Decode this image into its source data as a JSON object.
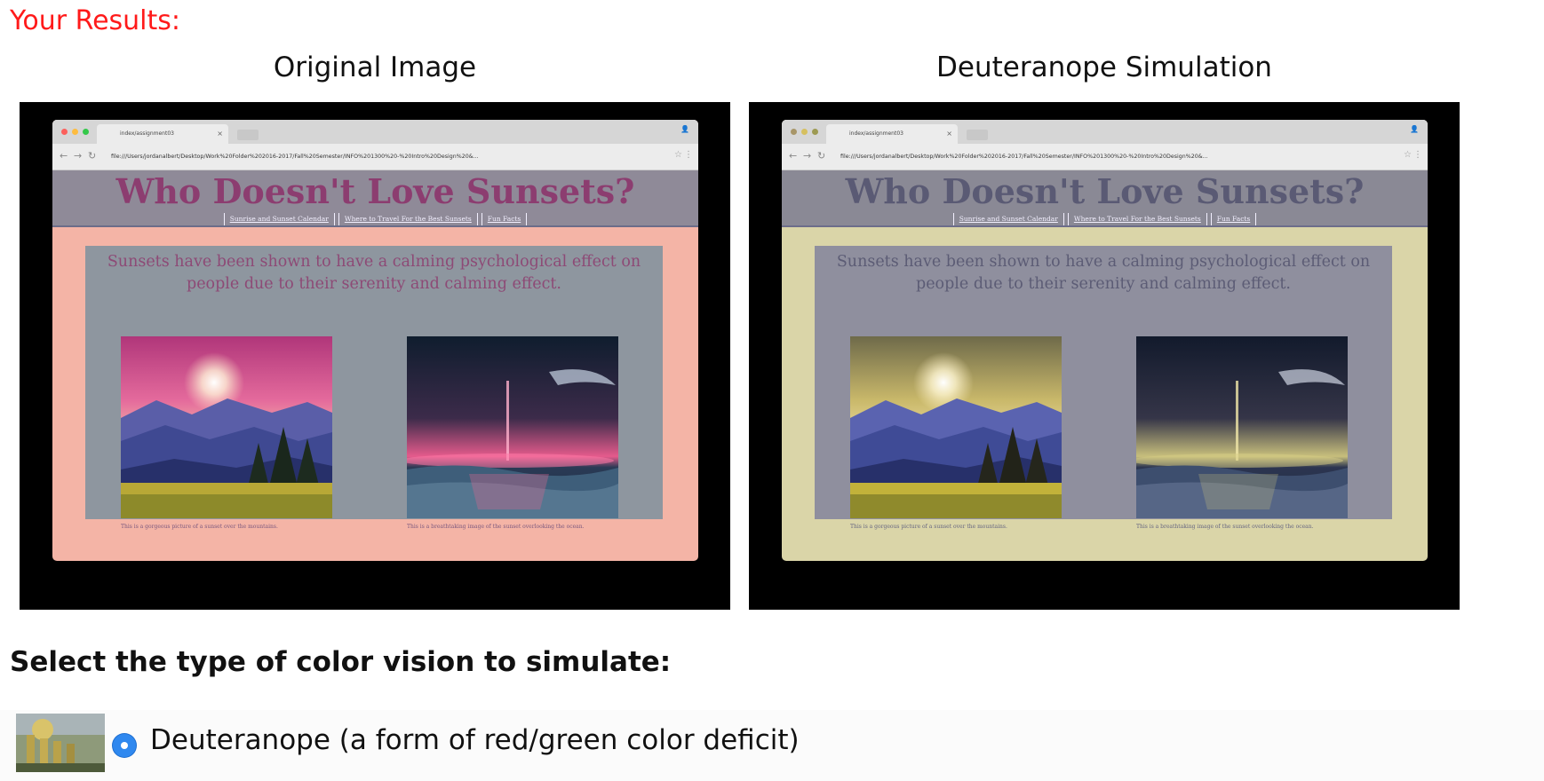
{
  "results_title": "Your Results:",
  "panels": [
    {
      "heading": "Original Image",
      "colors": {
        "page_bg": "#f4b4a6",
        "banner_bg": "#8f8a98",
        "title_color": "#8c3d70",
        "content_bg": "#8e969f",
        "text_color": "#8d4a76",
        "navbar_border": "#6c6d89",
        "caption_color": "#7b587e"
      },
      "screenshot": {
        "tab_title": "index/assignment03",
        "url": "file:///Users/jordanalbert/Desktop/Work%20Folder%202016-2017/Fall%20Semester/INFO%201300%20-%20Intro%20Design%20&...",
        "site_title": "Who Doesn't Love Sunsets?",
        "nav_links": [
          "Sunrise and Sunset Calendar",
          "Where to Travel For the Best Sunsets",
          "Fun Facts"
        ],
        "intro_text": "Sunsets have been shown to have a calming psychological effect on people due to their serenity and calming effect.",
        "captions": [
          "This is a gorgeous picture of a sunset over the mountains.",
          "This is a breathtaking image of the sunset overlooking the ocean."
        ]
      }
    },
    {
      "heading": "Deuteranope Simulation",
      "colors": {
        "page_bg": "#dad5a8",
        "banner_bg": "#8a8995",
        "title_color": "#5a5a74",
        "content_bg": "#8f8f9e",
        "text_color": "#5c5c75",
        "navbar_border": "#6d6d8a",
        "caption_color": "#666680"
      },
      "screenshot": {
        "tab_title": "index/assignment03",
        "url": "file:///Users/jordanalbert/Desktop/Work%20Folder%202016-2017/Fall%20Semester/INFO%201300%20-%20Intro%20Design%20&...",
        "site_title": "Who Doesn't Love Sunsets?",
        "nav_links": [
          "Sunrise and Sunset Calendar",
          "Where to Travel For the Best Sunsets",
          "Fun Facts"
        ],
        "intro_text": "Sunsets have been shown to have a calming psychological effect on people due to their serenity and calming effect.",
        "captions": [
          "This is a gorgeous picture of a sunset over the mountains.",
          "This is a breathtaking image of the sunset overlooking the ocean."
        ]
      }
    }
  ],
  "select_label": "Select the type of color vision to simulate:",
  "options": [
    {
      "label": "Deuteranope (a form of red/green color deficit)",
      "selected": true
    }
  ]
}
